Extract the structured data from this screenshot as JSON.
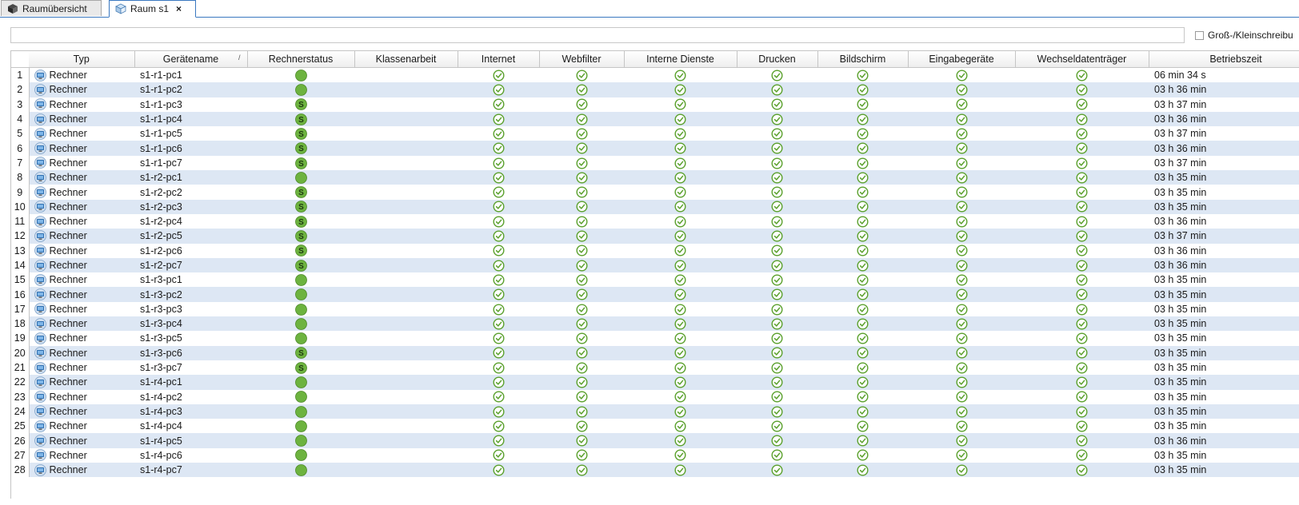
{
  "tabs": [
    {
      "label": "Raumübersicht",
      "icon": "cube-icon",
      "active": false
    },
    {
      "label": "Raum s1",
      "icon": "cube-outline-icon",
      "active": true,
      "close": "×"
    }
  ],
  "filter": {
    "value": "",
    "placeholder": "",
    "case_label": "Groß-/Kleinschreibu",
    "case_checked": false
  },
  "columns": [
    "Typ",
    "Gerätename",
    "Rechnerstatus",
    "Klassenarbeit",
    "Internet",
    "Webfilter",
    "Interne Dienste",
    "Drucken",
    "Bildschirm",
    "Eingabegeräte",
    "Wechseldatenträger",
    "Betriebszeit"
  ],
  "sort": {
    "column": "Gerätename",
    "indicator": "/"
  },
  "colors": {
    "status_green": "#6db33f",
    "check_green": "#5aa02c",
    "row_alt": "#dde7f4",
    "tab_accent": "#3a78c0"
  },
  "rows": [
    {
      "n": "1",
      "typ": "Rechner",
      "name": "s1-r1-pc1",
      "status": "on",
      "status_letter": "",
      "uptime": "06 min 34 s"
    },
    {
      "n": "2",
      "typ": "Rechner",
      "name": "s1-r1-pc2",
      "status": "on",
      "status_letter": "",
      "uptime": "03 h 36 min"
    },
    {
      "n": "3",
      "typ": "Rechner",
      "name": "s1-r1-pc3",
      "status": "session",
      "status_letter": "S",
      "uptime": "03 h 37 min"
    },
    {
      "n": "4",
      "typ": "Rechner",
      "name": "s1-r1-pc4",
      "status": "session",
      "status_letter": "S",
      "uptime": "03 h 36 min"
    },
    {
      "n": "5",
      "typ": "Rechner",
      "name": "s1-r1-pc5",
      "status": "session",
      "status_letter": "S",
      "uptime": "03 h 37 min"
    },
    {
      "n": "6",
      "typ": "Rechner",
      "name": "s1-r1-pc6",
      "status": "session",
      "status_letter": "S",
      "uptime": "03 h 36 min"
    },
    {
      "n": "7",
      "typ": "Rechner",
      "name": "s1-r1-pc7",
      "status": "session",
      "status_letter": "S",
      "uptime": "03 h 37 min"
    },
    {
      "n": "8",
      "typ": "Rechner",
      "name": "s1-r2-pc1",
      "status": "on",
      "status_letter": "",
      "uptime": "03 h 35 min"
    },
    {
      "n": "9",
      "typ": "Rechner",
      "name": "s1-r2-pc2",
      "status": "session",
      "status_letter": "S",
      "uptime": "03 h 35 min"
    },
    {
      "n": "10",
      "typ": "Rechner",
      "name": "s1-r2-pc3",
      "status": "session",
      "status_letter": "S",
      "uptime": "03 h 35 min"
    },
    {
      "n": "11",
      "typ": "Rechner",
      "name": "s1-r2-pc4",
      "status": "session",
      "status_letter": "S",
      "uptime": "03 h 36 min"
    },
    {
      "n": "12",
      "typ": "Rechner",
      "name": "s1-r2-pc5",
      "status": "session",
      "status_letter": "S",
      "uptime": "03 h 37 min"
    },
    {
      "n": "13",
      "typ": "Rechner",
      "name": "s1-r2-pc6",
      "status": "session",
      "status_letter": "S",
      "uptime": "03 h 36 min"
    },
    {
      "n": "14",
      "typ": "Rechner",
      "name": "s1-r2-pc7",
      "status": "session",
      "status_letter": "S",
      "uptime": "03 h 36 min"
    },
    {
      "n": "15",
      "typ": "Rechner",
      "name": "s1-r3-pc1",
      "status": "on",
      "status_letter": "",
      "uptime": "03 h 35 min"
    },
    {
      "n": "16",
      "typ": "Rechner",
      "name": "s1-r3-pc2",
      "status": "on",
      "status_letter": "",
      "uptime": "03 h 35 min"
    },
    {
      "n": "17",
      "typ": "Rechner",
      "name": "s1-r3-pc3",
      "status": "on",
      "status_letter": "",
      "uptime": "03 h 35 min"
    },
    {
      "n": "18",
      "typ": "Rechner",
      "name": "s1-r3-pc4",
      "status": "on",
      "status_letter": "",
      "uptime": "03 h 35 min"
    },
    {
      "n": "19",
      "typ": "Rechner",
      "name": "s1-r3-pc5",
      "status": "on",
      "status_letter": "",
      "uptime": "03 h 35 min"
    },
    {
      "n": "20",
      "typ": "Rechner",
      "name": "s1-r3-pc6",
      "status": "session",
      "status_letter": "S",
      "uptime": "03 h 35 min"
    },
    {
      "n": "21",
      "typ": "Rechner",
      "name": "s1-r3-pc7",
      "status": "session",
      "status_letter": "S",
      "uptime": "03 h 35 min"
    },
    {
      "n": "22",
      "typ": "Rechner",
      "name": "s1-r4-pc1",
      "status": "on",
      "status_letter": "",
      "uptime": "03 h 35 min"
    },
    {
      "n": "23",
      "typ": "Rechner",
      "name": "s1-r4-pc2",
      "status": "on",
      "status_letter": "",
      "uptime": "03 h 35 min"
    },
    {
      "n": "24",
      "typ": "Rechner",
      "name": "s1-r4-pc3",
      "status": "on",
      "status_letter": "",
      "uptime": "03 h 35 min"
    },
    {
      "n": "25",
      "typ": "Rechner",
      "name": "s1-r4-pc4",
      "status": "on",
      "status_letter": "",
      "uptime": "03 h 35 min"
    },
    {
      "n": "26",
      "typ": "Rechner",
      "name": "s1-r4-pc5",
      "status": "on",
      "status_letter": "",
      "uptime": "03 h 36 min"
    },
    {
      "n": "27",
      "typ": "Rechner",
      "name": "s1-r4-pc6",
      "status": "on",
      "status_letter": "",
      "uptime": "03 h 35 min"
    },
    {
      "n": "28",
      "typ": "Rechner",
      "name": "s1-r4-pc7",
      "status": "on",
      "status_letter": "",
      "uptime": "03 h 35 min"
    }
  ],
  "permission_icon": "check-circle-icon",
  "klassenarbeit_icon": ""
}
